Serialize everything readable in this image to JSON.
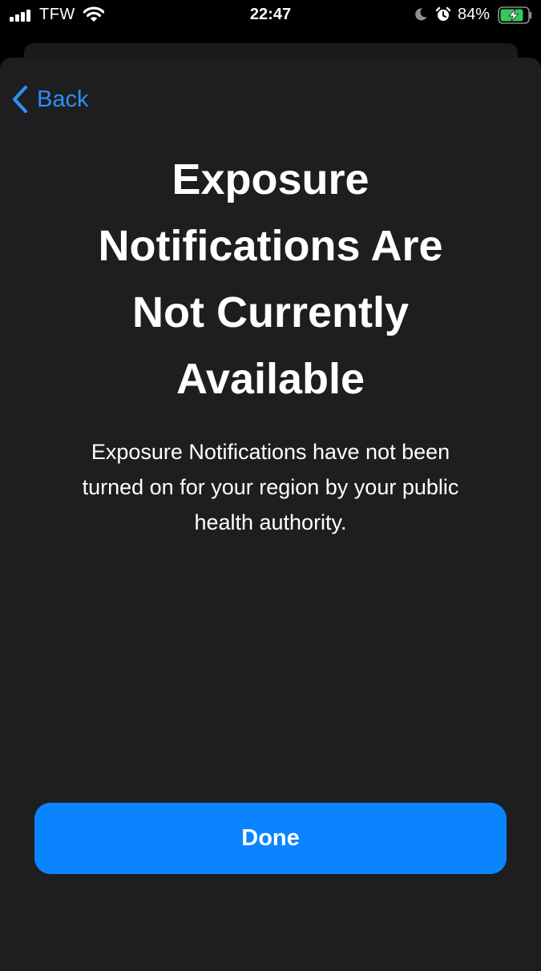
{
  "status_bar": {
    "carrier": "TFW",
    "time": "22:47",
    "battery_percent": "84%",
    "icons": [
      "signal-icon",
      "wifi-icon",
      "moon-icon",
      "alarm-icon",
      "battery-charging-icon"
    ]
  },
  "nav": {
    "back_label": "Back"
  },
  "content": {
    "title_lines": [
      "Exposure",
      "Notifications Are",
      "Not Currently",
      "Available"
    ],
    "body_lines": [
      "Exposure Notifications have not been",
      "turned on for your region by your public",
      "health authority."
    ]
  },
  "actions": {
    "done_label": "Done"
  },
  "colors": {
    "accent": "#0a84ff",
    "link": "#2b8ff7",
    "sheet_background": "#1e1e20",
    "battery_green": "#34c759"
  }
}
